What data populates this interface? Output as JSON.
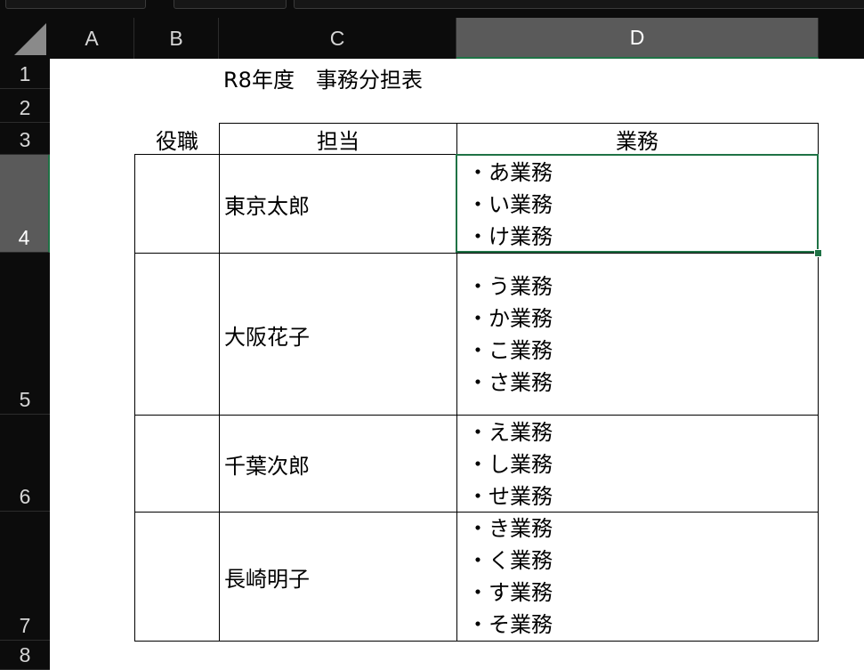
{
  "columns": [
    "A",
    "B",
    "C",
    "D"
  ],
  "rows": [
    "1",
    "2",
    "3",
    "4",
    "5",
    "6",
    "7",
    "8"
  ],
  "selected": {
    "column": "D",
    "row": "4"
  },
  "sheet": {
    "title": "R8年度　事務分担表",
    "headers": {
      "role": "役職",
      "person": "担当",
      "duties": "業務"
    },
    "entries": [
      {
        "role": "",
        "person": "東京太郎",
        "duties": [
          "・あ業務",
          "・い業務",
          "・け業務"
        ]
      },
      {
        "role": "",
        "person": "大阪花子",
        "duties": [
          "・う業務",
          "・か業務",
          "・こ業務",
          "・さ業務"
        ]
      },
      {
        "role": "",
        "person": "千葉次郎",
        "duties": [
          "・え業務",
          "・し業務",
          "・せ業務"
        ]
      },
      {
        "role": "",
        "person": "長崎明子",
        "duties": [
          "・き業務",
          "・く業務",
          "・す業務",
          "・そ業務"
        ]
      }
    ]
  },
  "colors": {
    "selection": "#1f7245",
    "header_bg": "#0c0c0c",
    "header_selected_bg": "#5a5a5a"
  }
}
